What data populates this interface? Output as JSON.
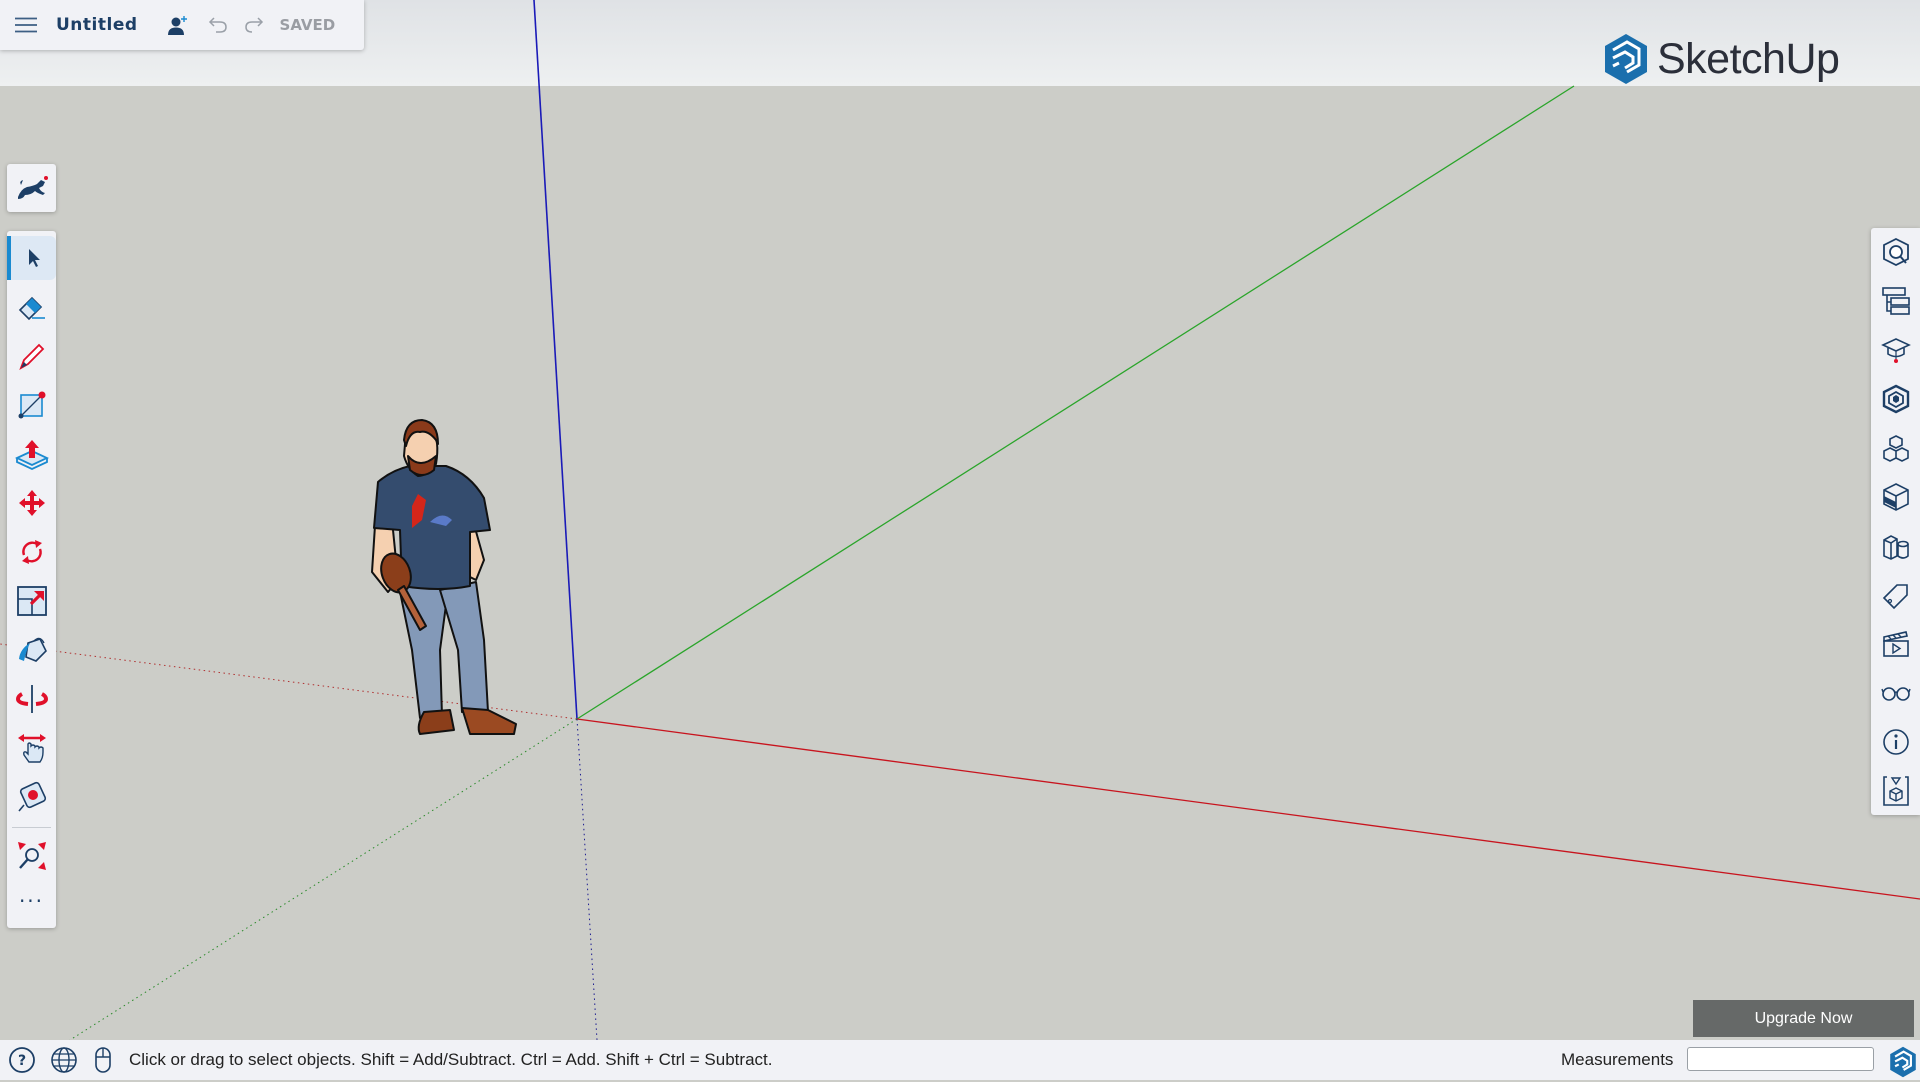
{
  "header": {
    "menu_icon": "hamburger-menu-icon",
    "title": "Untitled",
    "share_icon": "add-user-icon",
    "undo_icon": "undo-icon",
    "redo_icon": "redo-icon",
    "saved_label": "SAVED"
  },
  "brand": {
    "name": "SketchUp",
    "color": "#1b6fad"
  },
  "left_toolbar": {
    "top_button": {
      "name": "Search / Instructor",
      "icon": "running-dog-icon"
    },
    "tools": [
      {
        "name": "Select",
        "icon": "select-arrow-icon",
        "active": true
      },
      {
        "name": "Eraser",
        "icon": "eraser-icon"
      },
      {
        "name": "Line",
        "icon": "pencil-icon"
      },
      {
        "name": "Rectangle",
        "icon": "rectangle-icon"
      },
      {
        "name": "Push/Pull",
        "icon": "push-pull-icon"
      },
      {
        "name": "Move",
        "icon": "move-icon"
      },
      {
        "name": "Rotate",
        "icon": "rotate-icon"
      },
      {
        "name": "Scale",
        "icon": "scale-icon"
      },
      {
        "name": "Paint Bucket",
        "icon": "paint-bucket-icon"
      },
      {
        "name": "Orbit",
        "icon": "orbit-icon"
      },
      {
        "name": "Pan",
        "icon": "pan-icon"
      },
      {
        "name": "Tape Measure",
        "icon": "tape-measure-icon"
      },
      {
        "name": "Zoom Extents",
        "icon": "zoom-extents-icon"
      },
      {
        "name": "More",
        "icon": "more-dots-icon",
        "label": "..."
      }
    ]
  },
  "right_toolbar": {
    "panels": [
      {
        "name": "Entity Info",
        "icon": "entity-search-icon"
      },
      {
        "name": "Outliner",
        "icon": "outliner-icon"
      },
      {
        "name": "Instructor",
        "icon": "graduation-cap-icon"
      },
      {
        "name": "Components",
        "icon": "component-icon"
      },
      {
        "name": "3D Warehouse",
        "icon": "warehouse-cubes-icon"
      },
      {
        "name": "Materials",
        "icon": "materials-cube-icon"
      },
      {
        "name": "Styles",
        "icon": "styles-icon"
      },
      {
        "name": "Tags",
        "icon": "tag-icon"
      },
      {
        "name": "Scenes",
        "icon": "scenes-clapper-icon"
      },
      {
        "name": "Display",
        "icon": "glasses-icon"
      },
      {
        "name": "Model Info",
        "icon": "info-icon"
      },
      {
        "name": "Solid Inspector",
        "icon": "export-cube-icon"
      }
    ]
  },
  "viewport": {
    "axes": {
      "red": "#d0101c",
      "green": "#1ea01e",
      "blue": "#1010c0"
    },
    "figure": "scale-figure-person"
  },
  "upgrade_button": "Upgrade Now",
  "status_bar": {
    "help_icon": "help-icon",
    "globe_icon": "globe-icon",
    "mouse_icon": "mouse-icon",
    "message": "Click or drag to select objects. Shift = Add/Subtract. Ctrl = Add. Shift + Ctrl = Subtract.",
    "measurements_label": "Measurements",
    "measurements_value": ""
  }
}
